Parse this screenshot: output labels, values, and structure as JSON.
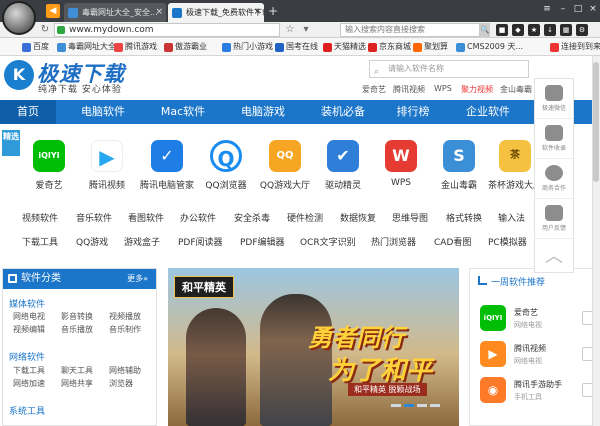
{
  "browser": {
    "tabs": [
      {
        "label": "毒霸网址大全_安全..."
      },
      {
        "label": "极速下载_免费软件下载"
      }
    ],
    "new_tab": "+",
    "address": "www.mydown.com",
    "search_placeholder": "输入搜索内容直接搜索",
    "bookmarks": [
      "百度",
      "毒霸网址大全",
      "腾讯游戏",
      "傲游霸业",
      "热门小游戏",
      "国考在线",
      "天猫精选",
      "京东商城",
      "聚划算",
      "CMS2009 天...",
      "连接到到来"
    ]
  },
  "site": {
    "logo_mark": "K",
    "logo_title": "极速下载",
    "slogan": "纯净下载  安心体验",
    "search_placeholder": "请输入软件名称",
    "hot_searches": [
      "爱奇艺",
      "腾讯视频",
      "WPS",
      "聚力视频",
      "金山毒霸"
    ],
    "nav": [
      "首页",
      "电脑软件",
      "Mac软件",
      "电脑游戏",
      "装机必备",
      "排行榜",
      "企业软件"
    ],
    "featured_badge": "精选",
    "featured_apps": [
      {
        "name": "爱奇艺",
        "icon": "iQIYI",
        "color": "#00be06"
      },
      {
        "name": "腾讯视频",
        "icon": "▶",
        "color": "#ffffff"
      },
      {
        "name": "腾讯电脑管家",
        "icon": "✓",
        "color": "#1f7ee5"
      },
      {
        "name": "QQ浏览器",
        "icon": "Q",
        "color": "#ffffff"
      },
      {
        "name": "QQ游戏大厅",
        "icon": "QQ",
        "color": "#f6a623"
      },
      {
        "name": "驱动精灵",
        "icon": "✔",
        "color": "#2f7fd8"
      },
      {
        "name": "WPS",
        "icon": "W",
        "color": "#e53b32"
      },
      {
        "name": "金山毒霸",
        "icon": "S",
        "color": "#3b8fd6"
      },
      {
        "name": "茶杯游戏大厅",
        "icon": "茶",
        "color": "#f4c240"
      }
    ],
    "tags_row1": [
      "视频软件",
      "音乐软件",
      "看图软件",
      "办公软件",
      "安全杀毒",
      "硬件检测",
      "数据恢复",
      "思维导图",
      "格式转换",
      "输入法"
    ],
    "tags_row2": [
      "下载工具",
      "QQ游戏",
      "游戏盒子",
      "PDF阅读器",
      "PDF编辑器",
      "OCR文字识别",
      "热门浏览器",
      "CAD看图",
      "PC模拟器"
    ]
  },
  "category_panel": {
    "title": "软件分类",
    "more": "更多»",
    "groups": [
      {
        "title": "媒体软件",
        "rows": [
          [
            "网络电视",
            "影音转换",
            "视频播放"
          ],
          [
            "视频编辑",
            "音乐播放",
            "音乐制作"
          ]
        ]
      },
      {
        "title": "网络软件",
        "rows": [
          [
            "下载工具",
            "聊天工具",
            "网络辅助"
          ],
          [
            "网络加速",
            "网络共享",
            "浏览器"
          ]
        ]
      },
      {
        "title": "系统工具",
        "rows": []
      }
    ]
  },
  "banner": {
    "logo": "和平精英",
    "title_line1": "勇者同行",
    "title_line2": "为了和平",
    "subtitle": "和平精英  脱颖战场",
    "slides": 4,
    "active_slide": 2
  },
  "recommend": {
    "title": "一周软件推荐",
    "items": [
      {
        "name": "爱奇艺",
        "desc": "网络电视",
        "icon": "iQIYI",
        "color": "#00be06"
      },
      {
        "name": "腾讯视频",
        "desc": "网络电视",
        "icon": "▶",
        "color": "#ff8a1f"
      },
      {
        "name": "腾讯手游助手",
        "desc": "手机工具",
        "icon": "◉",
        "color": "#ff7a28"
      }
    ]
  },
  "floating_bar": {
    "items": [
      "极速微信",
      "软件收录",
      "商务合作",
      "用户反馈"
    ],
    "back_to_top": "︿"
  },
  "colors": {
    "accent": "#1b75c9",
    "tab_bar": "#3a3d42"
  }
}
